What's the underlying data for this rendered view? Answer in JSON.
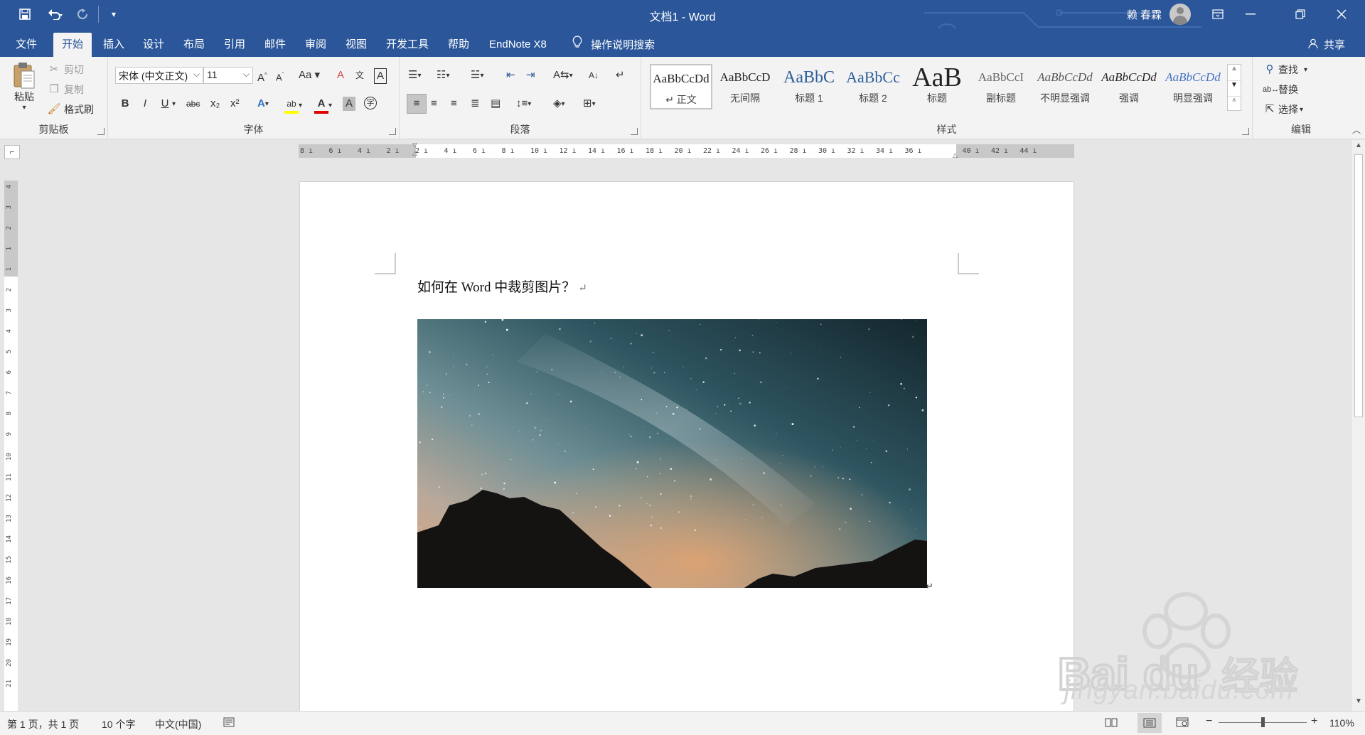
{
  "window": {
    "title": "文档1  -  Word",
    "user_name": "赖 春霖",
    "controls": [
      "ribbon-display-icon",
      "minimize-icon",
      "restore-icon",
      "close-icon"
    ]
  },
  "quick_access": {
    "icons": [
      "save-icon",
      "undo-icon",
      "redo-icon",
      "customize-icon"
    ]
  },
  "tabs": [
    {
      "label": "文件",
      "active": false
    },
    {
      "label": "开始",
      "active": true
    },
    {
      "label": "插入",
      "active": false
    },
    {
      "label": "设计",
      "active": false
    },
    {
      "label": "布局",
      "active": false
    },
    {
      "label": "引用",
      "active": false
    },
    {
      "label": "邮件",
      "active": false
    },
    {
      "label": "审阅",
      "active": false
    },
    {
      "label": "视图",
      "active": false
    },
    {
      "label": "开发工具",
      "active": false
    },
    {
      "label": "帮助",
      "active": false
    },
    {
      "label": "EndNote X8",
      "active": false
    }
  ],
  "tell_me": "操作说明搜索",
  "share": "共享",
  "ribbon": {
    "clipboard": {
      "label": "剪贴板",
      "paste": "粘贴",
      "cut": "剪切",
      "copy": "复制",
      "format_painter": "格式刷"
    },
    "font": {
      "label": "字体",
      "font_name": "宋体 (中文正文)",
      "font_size": "11",
      "buttons": [
        "B",
        "I",
        "U",
        "abc",
        "x₂",
        "x²",
        "Aa"
      ]
    },
    "paragraph": {
      "label": "段落"
    },
    "styles": {
      "label": "样式",
      "items": [
        {
          "sample": "AaBbCcDd",
          "name": "↵ 正文",
          "selected": true
        },
        {
          "sample": "AaBbCcD",
          "name": "无间隔",
          "selected": false
        },
        {
          "sample": "AaBbC",
          "name": "标题 1",
          "selected": false
        },
        {
          "sample": "AaBbCc",
          "name": "标题 2",
          "selected": false
        },
        {
          "sample": "AaB",
          "name": "标题",
          "selected": false
        },
        {
          "sample": "AaBbCcI",
          "name": "副标题",
          "selected": false
        },
        {
          "sample": "AaBbCcDd",
          "name": "不明显强调",
          "selected": false
        },
        {
          "sample": "AaBbCcDd",
          "name": "强调",
          "selected": false
        },
        {
          "sample": "AaBbCcDd",
          "name": "明显强调",
          "selected": false
        }
      ]
    },
    "editing": {
      "label": "编辑",
      "find": "查找",
      "replace": "替换",
      "select": "选择"
    }
  },
  "ruler": {
    "h_ticks": [
      "8",
      "6",
      "4",
      "2",
      "2",
      "4",
      "6",
      "8",
      "10",
      "12",
      "14",
      "16",
      "18",
      "20",
      "22",
      "24",
      "26",
      "28",
      "30",
      "32",
      "34",
      "36",
      "40",
      "42",
      "44"
    ],
    "v_ticks": [
      "4",
      "3",
      "2",
      "1",
      "1",
      "2",
      "3",
      "4",
      "5",
      "6",
      "7",
      "8",
      "9",
      "10",
      "11",
      "12",
      "13",
      "14",
      "15",
      "16",
      "17",
      "18",
      "19",
      "20",
      "21"
    ]
  },
  "document": {
    "text": "如何在 Word 中裁剪图片？",
    "paragraph_mark": "↵",
    "image_alt": "starry night sky over mountain silhouette"
  },
  "watermark": {
    "text": "jingyan.baidu.com"
  },
  "statusbar": {
    "page": "第 1 页，共 1 页",
    "words": "10 个字",
    "language": "中文(中国)",
    "zoom": "110%"
  },
  "colors": {
    "accent": "#2b579a",
    "ribbon_bg": "#f3f3f3",
    "canvas_bg": "#e6e6e6"
  }
}
